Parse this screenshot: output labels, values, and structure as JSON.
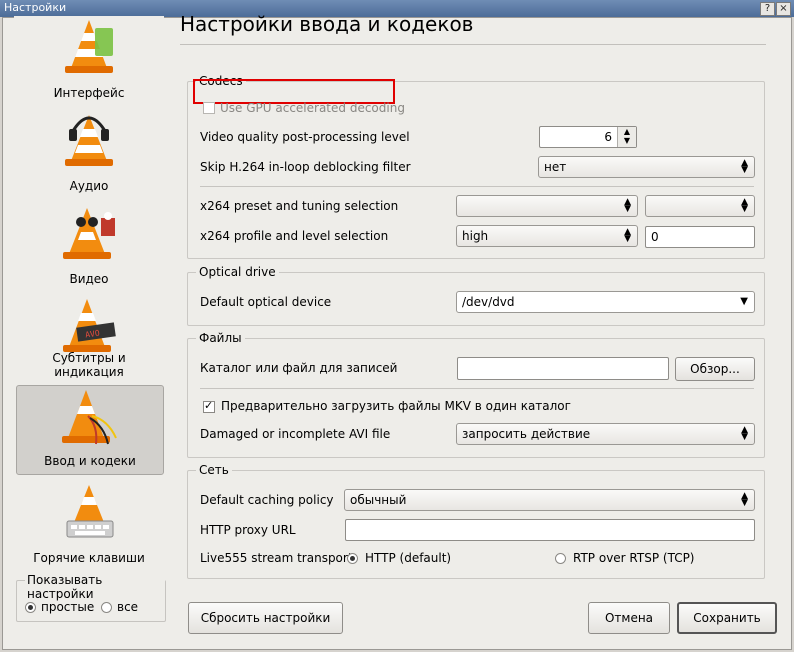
{
  "window": {
    "title": "Настройки",
    "btn_help": "?",
    "btn_close": "×"
  },
  "sidebar": {
    "items": [
      {
        "label": "Интерфейс",
        "icon": "vlc-cone-interface-icon"
      },
      {
        "label": "Аудио",
        "icon": "vlc-cone-headphones-icon"
      },
      {
        "label": "Видео",
        "icon": "vlc-cone-glasses-icon"
      },
      {
        "label": "Субтитры и индикация",
        "icon": "vlc-cone-subtitles-icon"
      },
      {
        "label": "Ввод и кодеки",
        "icon": "vlc-cone-cables-icon",
        "selected": true
      },
      {
        "label": "Горячие клавиши",
        "icon": "vlc-cone-keyboard-icon"
      }
    ],
    "show_settings": {
      "legend": "Показывать настройки",
      "simple": "простые",
      "all": "все",
      "selected": "простые"
    }
  },
  "main": {
    "heading": "Настройки ввода и кодеков",
    "codecs": {
      "title": "Codecs",
      "gpu_label": "Use GPU accelerated decoding",
      "gpu_checked": false,
      "quality_label": "Video quality post-processing level",
      "quality_value": "6",
      "skip_label": "Skip H.264 in-loop deblocking filter",
      "skip_value": "нет",
      "x264_preset_label": "x264 preset and tuning selection",
      "x264_preset_value": "",
      "x264_tuning_value": "",
      "x264_profile_label": "x264 profile and level selection",
      "x264_profile_value": "high",
      "x264_level_value": "0"
    },
    "optical": {
      "title": "Optical drive",
      "device_label": "Default optical device",
      "device_value": "/dev/dvd"
    },
    "files": {
      "title": "Файлы",
      "record_label": "Каталог или файл для записей",
      "record_value": "",
      "browse_label": "Обзор...",
      "mkv_label": "Предварительно загрузить файлы MKV в один каталог",
      "mkv_checked": true,
      "avi_label": "Damaged or incomplete AVI file",
      "avi_value": "запросить действие"
    },
    "network": {
      "title": "Сеть",
      "caching_label": "Default caching policy",
      "caching_value": "обычный",
      "proxy_label": "HTTP proxy URL",
      "proxy_value": "",
      "transport_label": "Live555 stream transport",
      "http_label": "HTTP (default)",
      "rtp_label": "RTP over RTSP (TCP)",
      "transport_selected": "HTTP (default)"
    }
  },
  "buttons": {
    "reset_label": "Сбросить настройки",
    "cancel_label": "Отмена",
    "save_label": "Сохранить"
  },
  "colors": {
    "highlight_box": "#e00000",
    "titlebar": "#5b7aa6"
  }
}
